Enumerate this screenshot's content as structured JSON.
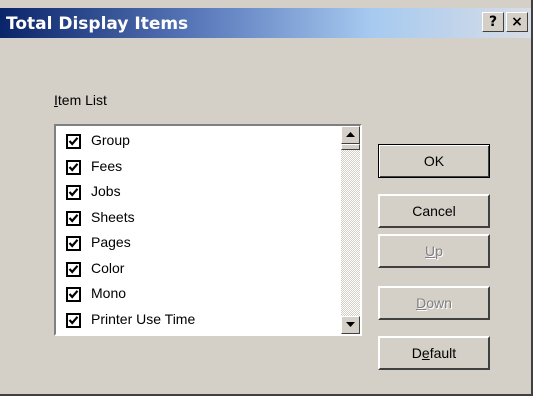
{
  "window": {
    "title": "Total Display Items",
    "help_button": "?",
    "close_button": "×"
  },
  "item_list": {
    "label_prefix": "",
    "label_mnemonic": "I",
    "label_rest": "tem List",
    "items": [
      {
        "label": "Group",
        "checked": true
      },
      {
        "label": "Fees",
        "checked": true
      },
      {
        "label": "Jobs",
        "checked": true
      },
      {
        "label": "Sheets",
        "checked": true
      },
      {
        "label": "Pages",
        "checked": true
      },
      {
        "label": "Color",
        "checked": true
      },
      {
        "label": "Mono",
        "checked": true
      },
      {
        "label": "Printer Use Time",
        "checked": true
      }
    ]
  },
  "buttons": {
    "ok": "OK",
    "cancel": "Cancel",
    "up_mnemonic": "U",
    "up_rest": "p",
    "down_mnemonic": "D",
    "down_rest": "own",
    "default_prefix": "D",
    "default_mnemonic": "e",
    "default_rest": "fault"
  }
}
